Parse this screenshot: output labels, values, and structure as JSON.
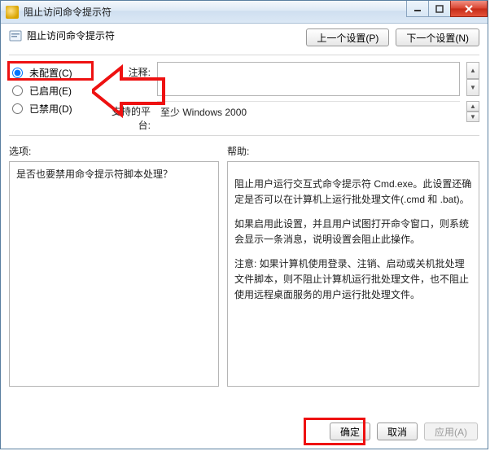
{
  "window": {
    "title": "阻止访问命令提示符"
  },
  "header": {
    "page_title": "阻止访问命令提示符",
    "prev_label": "上一个设置(P)",
    "next_label": "下一个设置(N)"
  },
  "radios": {
    "not_configured": "未配置(C)",
    "enabled": "已启用(E)",
    "disabled": "已禁用(D)",
    "selected": "not_configured"
  },
  "fields": {
    "comment_label": "注释:",
    "comment_value": "",
    "platform_label": "支持的平台:",
    "platform_value": "至少 Windows 2000"
  },
  "columns": {
    "options_header": "选项:",
    "help_header": "帮助:"
  },
  "options": {
    "text": "是否也要禁用命令提示符脚本处理？"
  },
  "help": {
    "p1": "阻止用户运行交互式命令提示符 Cmd.exe。此设置还确定是否可以在计算机上运行批处理文件(.cmd 和 .bat)。",
    "p2": "如果启用此设置，并且用户试图打开命令窗口，则系统会显示一条消息，说明设置会阻止此操作。",
    "p3": "注意: 如果计算机使用登录、注销、启动或关机批处理文件脚本，则不阻止计算机运行批处理文件，也不阻止使用远程桌面服务的用户运行批处理文件。"
  },
  "footer": {
    "ok": "确定",
    "cancel": "取消",
    "apply": "应用(A)"
  }
}
